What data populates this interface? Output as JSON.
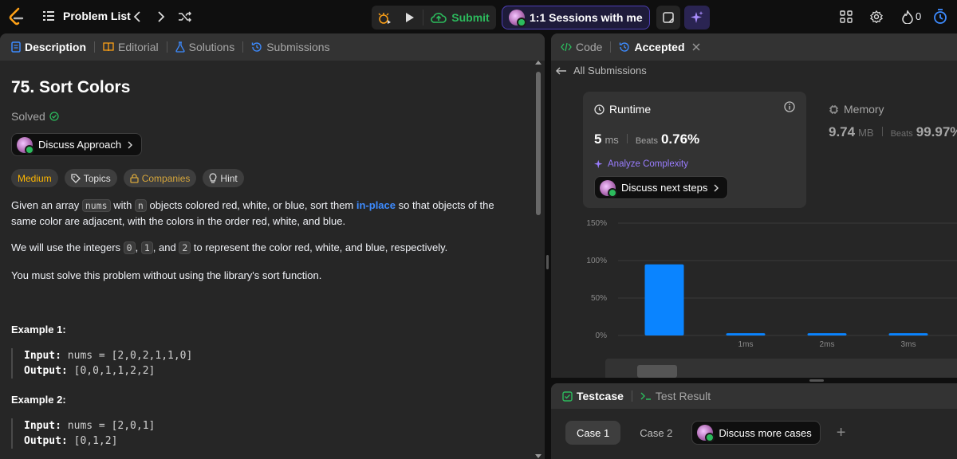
{
  "topbar": {
    "problem_list": "Problem List",
    "submit": "Submit",
    "sessions": "1:1 Sessions with me",
    "fire_count": "0"
  },
  "left_tabs": [
    "Description",
    "Editorial",
    "Solutions",
    "Submissions"
  ],
  "problem": {
    "title": "75. Sort Colors",
    "solved": "Solved",
    "discuss_approach": "Discuss Approach",
    "chips": [
      "Medium",
      "Topics",
      "Companies",
      "Hint"
    ],
    "p1_a": "Given an array ",
    "p1_code1": "nums",
    "p1_b": " with ",
    "p1_code2": "n",
    "p1_c": " objects colored red, white, or blue, sort them ",
    "p1_link": "in-place",
    "p1_d": " so that objects of the same color are adjacent, with the colors in the order red, white, and blue.",
    "p2_a": "We will use the integers ",
    "p2_c0": "0",
    "p2_b": ", ",
    "p2_c1": "1",
    "p2_c": ", and ",
    "p2_c2": "2",
    "p2_d": " to represent the color red, white, and blue, respectively.",
    "p3": "You must solve this problem without using the library's sort function.",
    "examples": [
      {
        "title": "Example 1:",
        "input_label": "Input:",
        "input": " nums = [2,0,2,1,1,0]",
        "output_label": "Output:",
        "output": " [0,0,1,1,2,2]"
      },
      {
        "title": "Example 2:",
        "input_label": "Input:",
        "input": " nums = [2,0,1]",
        "output_label": "Output:",
        "output": " [0,1,2]"
      }
    ]
  },
  "right_tabs": {
    "code": "Code",
    "accepted": "Accepted"
  },
  "all_submissions": "All Submissions",
  "runtime": {
    "label": "Runtime",
    "value": "5",
    "unit": "ms",
    "beats_label": "Beats",
    "beats": "0.76%",
    "analyze": "Analyze Complexity",
    "discuss_next": "Discuss next steps"
  },
  "memory": {
    "label": "Memory",
    "value": "9.74",
    "unit": "MB",
    "beats_label": "Beats",
    "beats": "99.97%"
  },
  "bottom_tabs": {
    "testcase": "Testcase",
    "result": "Test Result"
  },
  "cases": [
    "Case 1",
    "Case 2"
  ],
  "discuss_more": "Discuss more cases",
  "colors": {
    "accent_green": "#2cbb5d",
    "bar_blue": "#0a84ff",
    "medium": "#ffb700",
    "link": "#3d8bff"
  },
  "chart_data": {
    "type": "bar",
    "categories": [
      "",
      "1ms",
      "2ms",
      "3ms"
    ],
    "values": [
      95,
      3,
      3,
      3
    ],
    "ytick_labels": [
      "0%",
      "50%",
      "100%",
      "150%"
    ],
    "ylim": [
      0,
      150
    ],
    "grid": true
  }
}
